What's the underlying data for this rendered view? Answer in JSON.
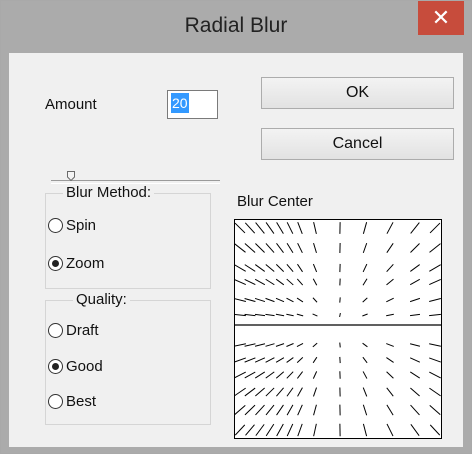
{
  "window": {
    "title": "Radial Blur",
    "close_glyph": "✕"
  },
  "amount": {
    "label": "Amount",
    "value": "20"
  },
  "buttons": {
    "ok": "OK",
    "cancel": "Cancel"
  },
  "blur_method": {
    "title": "Blur Method:",
    "options": [
      {
        "label": "Spin",
        "selected": false
      },
      {
        "label": "Zoom",
        "selected": true
      }
    ]
  },
  "quality": {
    "title": "Quality:",
    "options": [
      {
        "label": "Draft",
        "selected": false
      },
      {
        "label": "Good",
        "selected": true
      },
      {
        "label": "Best",
        "selected": false
      }
    ]
  },
  "blur_center": {
    "label": "Blur Center"
  },
  "colors": {
    "titlebar": "#ababab",
    "close": "#c74c3c",
    "client": "#f0f0f0",
    "selection": "#3399ff"
  }
}
